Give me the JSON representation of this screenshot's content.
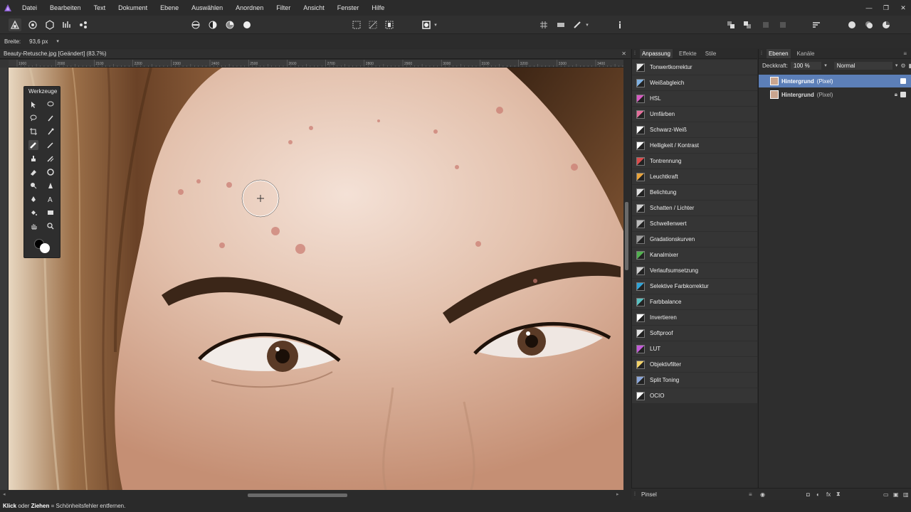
{
  "menu": {
    "items": [
      "Datei",
      "Bearbeiten",
      "Text",
      "Dokument",
      "Ebene",
      "Auswählen",
      "Anordnen",
      "Filter",
      "Ansicht",
      "Fenster",
      "Hilfe"
    ]
  },
  "contextbar": {
    "label": "Breite:",
    "value": "93,6 px"
  },
  "document": {
    "title": "Beauty-Retusche.jpg [Geändert] (83.7%)"
  },
  "ruler": {
    "h_ticks": [
      "1900",
      "2000",
      "2100",
      "2200",
      "2300",
      "2400",
      "2500",
      "2600",
      "2700",
      "2800",
      "2900",
      "3000",
      "3100",
      "3200",
      "3300",
      "3400"
    ]
  },
  "tools": {
    "title": "Werkzeuge"
  },
  "adjustments": {
    "tabs": [
      "Anpassung",
      "Effekte",
      "Stile"
    ],
    "items": [
      {
        "label": "Tonwertkorrektur",
        "color": "#eaeaea"
      },
      {
        "label": "Weißabgleich",
        "color": "#7fb0e0"
      },
      {
        "label": "HSL",
        "color": "#d65ac2"
      },
      {
        "label": "Umfärben",
        "color": "#e26f9b"
      },
      {
        "label": "Schwarz-Weiß",
        "color": "#ffffff"
      },
      {
        "label": "Helligkeit / Kontrast",
        "color": "#ffffff"
      },
      {
        "label": "Tontrennung",
        "color": "#d94b4b"
      },
      {
        "label": "Leuchtkraft",
        "color": "#e8a33b"
      },
      {
        "label": "Belichtung",
        "color": "#dddddd"
      },
      {
        "label": "Schatten / Lichter",
        "color": "#cfcfcf"
      },
      {
        "label": "Schwellenwert",
        "color": "#bbbbbb"
      },
      {
        "label": "Gradationskurven",
        "color": "#9a9a9a"
      },
      {
        "label": "Kanalmixer",
        "color": "#52b04f"
      },
      {
        "label": "Verlaufsumsetzung",
        "color": "#cccccc"
      },
      {
        "label": "Selektive Farbkorrektur",
        "color": "#2fa3d6"
      },
      {
        "label": "Farbbalance",
        "color": "#58c0c0"
      },
      {
        "label": "Invertieren",
        "color": "#ffffff"
      },
      {
        "label": "Softproof",
        "color": "#e0e0e0"
      },
      {
        "label": "LUT",
        "color": "#c35ad8"
      },
      {
        "label": "Objektivfilter",
        "color": "#f2d26a"
      },
      {
        "label": "Split Toning",
        "color": "#8aa5d8"
      },
      {
        "label": "OCIO",
        "color": "#ffffff"
      }
    ]
  },
  "layers": {
    "tabs": [
      "Ebenen",
      "Kanäle"
    ],
    "opacity_label": "Deckkraft:",
    "opacity_value": "100 %",
    "blend_mode": "Normal",
    "rows": [
      {
        "name": "Hintergrund",
        "type": "(Pixel)",
        "selected": true
      },
      {
        "name": "Hintergrund",
        "type": "(Pixel)",
        "selected": false
      }
    ]
  },
  "bottom_panel": {
    "label": "Pinsel"
  },
  "status": {
    "bold1": "Klick",
    "mid": " oder ",
    "bold2": "Ziehen",
    "rest": " = Schönheitsfehler entfernen."
  },
  "colors": {
    "accent": "#5c7fb8",
    "brand": "#8a5cd1"
  }
}
